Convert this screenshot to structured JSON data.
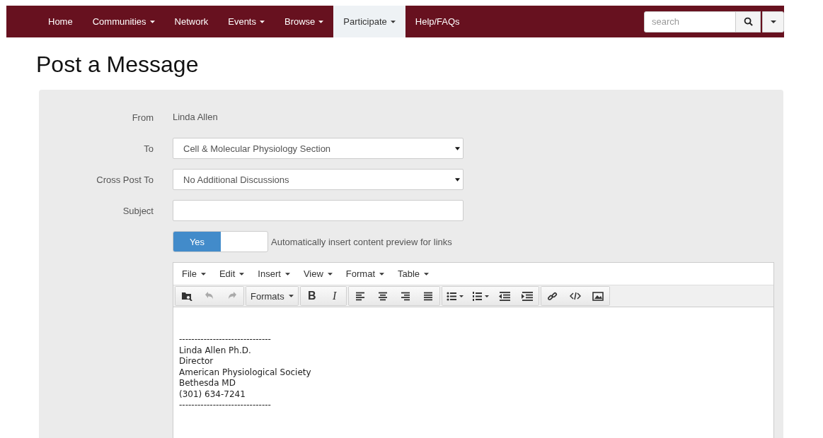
{
  "navbar": {
    "items": [
      {
        "label": "Home",
        "dropdown": false,
        "selected": false
      },
      {
        "label": "Communities",
        "dropdown": true,
        "selected": false
      },
      {
        "label": "Network",
        "dropdown": false,
        "selected": false
      },
      {
        "label": "Events",
        "dropdown": true,
        "selected": false
      },
      {
        "label": "Browse",
        "dropdown": true,
        "selected": false
      },
      {
        "label": "Participate",
        "dropdown": true,
        "selected": true
      },
      {
        "label": "Help/FAQs",
        "dropdown": false,
        "selected": false
      }
    ],
    "search": {
      "placeholder": "search"
    }
  },
  "page_title": "Post a Message",
  "form": {
    "fields": [
      {
        "label": "From",
        "kind": "static",
        "value": "Linda Allen"
      },
      {
        "label": "To",
        "kind": "select",
        "value": "Cell & Molecular Physiology Section"
      },
      {
        "label": "Cross Post To",
        "kind": "select",
        "value": "No Additional Discussions"
      },
      {
        "label": "Subject",
        "kind": "text"
      }
    ],
    "preview_toggle": {
      "on": true,
      "on_label": "Yes",
      "label": "Automatically insert content preview for links"
    }
  },
  "editor": {
    "menu": [
      "File",
      "Edit",
      "Insert",
      "View",
      "Format",
      "Table"
    ],
    "toolbar": [
      [
        {
          "kind": "browse",
          "disabled": false
        },
        {
          "kind": "undo",
          "disabled": true
        },
        {
          "kind": "redo",
          "disabled": true
        }
      ],
      [
        {
          "kind": "formats",
          "label": "Formats",
          "disabled": false
        }
      ],
      [
        {
          "kind": "bold",
          "label": "B",
          "disabled": false
        },
        {
          "kind": "italic",
          "label": "I",
          "disabled": false
        }
      ],
      [
        {
          "kind": "align-left",
          "disabled": false
        },
        {
          "kind": "align-center",
          "disabled": false
        },
        {
          "kind": "align-right",
          "disabled": false
        },
        {
          "kind": "justify",
          "disabled": false
        }
      ],
      [
        {
          "kind": "bullets",
          "disabled": false
        },
        {
          "kind": "numbers",
          "disabled": false
        },
        {
          "kind": "outdent",
          "disabled": false
        },
        {
          "kind": "indent",
          "disabled": false
        }
      ],
      [
        {
          "kind": "link",
          "disabled": false
        },
        {
          "kind": "code",
          "disabled": false
        },
        {
          "kind": "image",
          "disabled": false
        }
      ]
    ],
    "content": [
      "------------------------------",
      "Linda Allen Ph.D.",
      "Director",
      "American Physiological Society",
      "Bethesda MD",
      "(301) 634-7241",
      "------------------------------"
    ]
  }
}
